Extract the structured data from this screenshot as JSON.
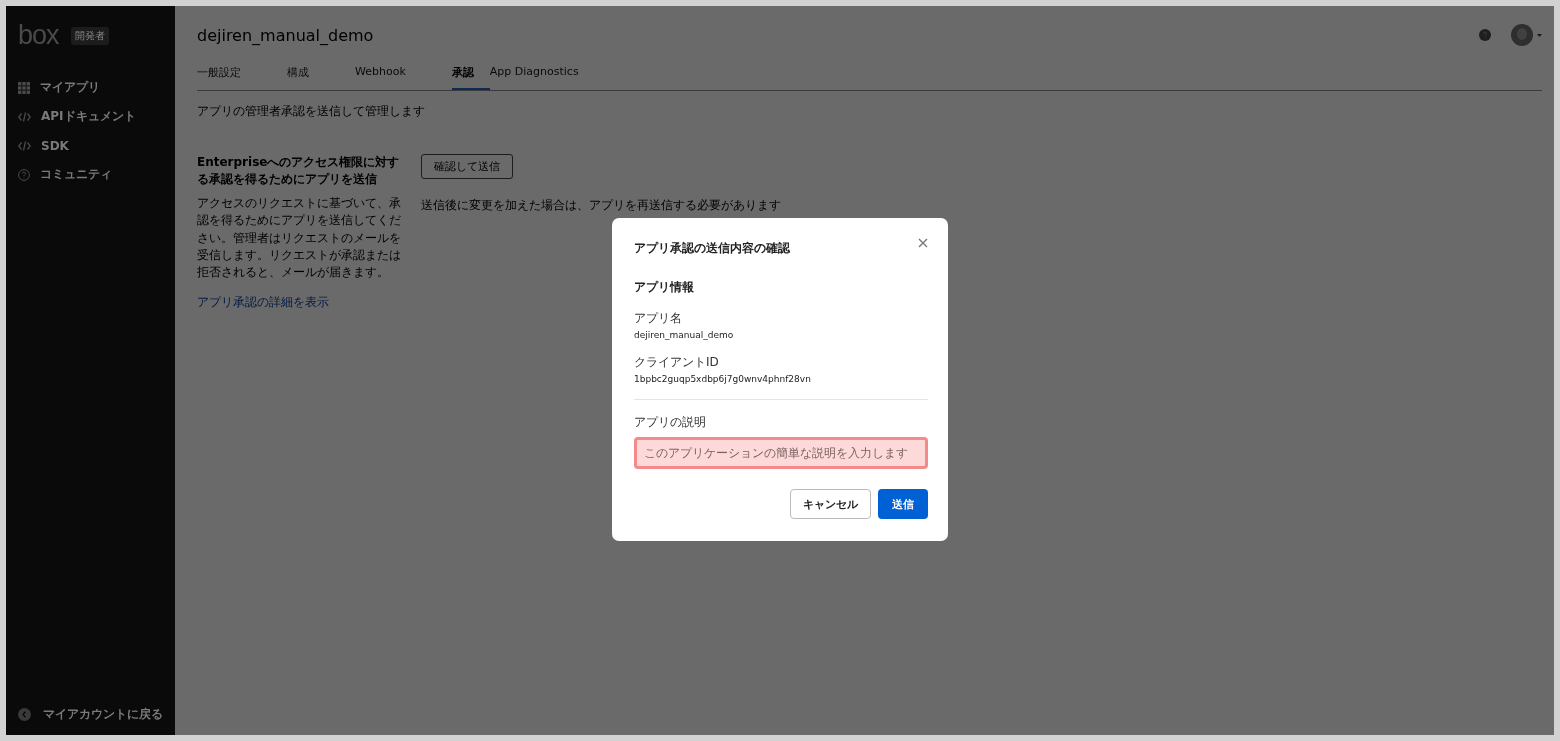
{
  "sidebar": {
    "logo": "box",
    "badge": "開発者",
    "items": [
      {
        "kind": "grid",
        "label": "マイアプリ"
      },
      {
        "kind": "code",
        "label": "APIドキュメント"
      },
      {
        "kind": "code",
        "label": "SDK"
      },
      {
        "kind": "help",
        "label": "コミュニティ"
      }
    ],
    "footer": "マイアカウントに戻る"
  },
  "header": {
    "app_name": "dejiren_manual_demo"
  },
  "tabs": [
    {
      "label": "一般設定",
      "selected": false
    },
    {
      "label": "構成",
      "selected": false
    },
    {
      "label": "Webhook",
      "selected": false
    },
    {
      "label": "承認",
      "selected": true
    },
    {
      "label": "App Diagnostics",
      "selected": false
    }
  ],
  "intro": "アプリの管理者承認を送信して管理します",
  "section": {
    "title": "Enterpriseへのアクセス権限に対する承認を得るためにアプリを送信",
    "description": "アクセスのリクエストに基づいて、承認を得るためにアプリを送信してください。管理者はリクエストのメールを受信します。リクエストが承認または拒否されると、メールが届きます。",
    "link": "アプリ承認の詳細を表示",
    "button": "確認して送信",
    "note": "送信後に変更を加えた場合は、アプリを再送信する必要があります"
  },
  "dialog": {
    "title": "アプリ承認の送信内容の確認",
    "subtitle": "アプリ情報",
    "fields": [
      {
        "label": "アプリ名",
        "value": "dejiren_manual_demo"
      },
      {
        "label": "クライアントID",
        "value": "1bpbc2guqp5xdbp6j7g0wnv4phnf28vn"
      }
    ],
    "description_label": "アプリの説明",
    "description_placeholder": "このアプリケーションの簡単な説明を入力します",
    "description_error": true,
    "cancel": "キャンセル",
    "submit": "送信"
  }
}
